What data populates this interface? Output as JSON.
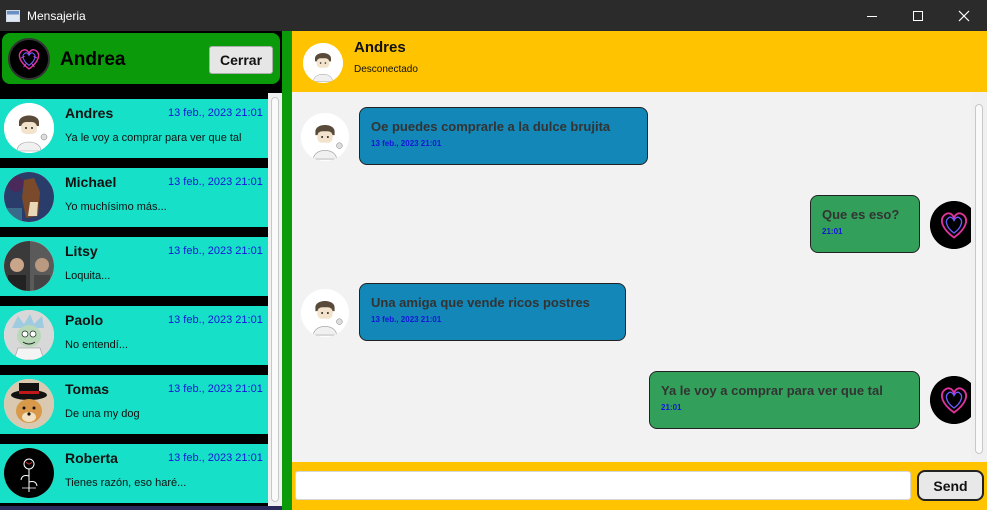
{
  "window": {
    "title": "Mensajeria",
    "controls": [
      "minimize-icon",
      "maximize-icon",
      "close-icon"
    ]
  },
  "profile": {
    "name": "Andrea",
    "close_label": "Cerrar",
    "avatar_icon": "neon-heart-avatar"
  },
  "contacts": [
    {
      "name": "Andres",
      "date": "13 feb., 2023  21:01",
      "last_message": "Ya le voy a comprar para ver que tal",
      "avatar_icon": "cartoon-boy-avatar"
    },
    {
      "name": "Michael",
      "date": "13 feb., 2023  21:01",
      "last_message": "Yo muchísimo más...",
      "avatar_icon": "horse-cartoon-avatar"
    },
    {
      "name": "Litsy",
      "date": "13 feb., 2023  21:01",
      "last_message": "Loquita...",
      "avatar_icon": "photo-collage-avatar"
    },
    {
      "name": "Paolo",
      "date": "13 feb., 2023  21:01",
      "last_message": "No entendí...",
      "avatar_icon": "scientist-cartoon-avatar"
    },
    {
      "name": "Tomas",
      "date": "13 feb., 2023  21:01",
      "last_message": "De una my dog",
      "avatar_icon": "dog-with-hat-avatar"
    },
    {
      "name": "Roberta",
      "date": "13 feb., 2023  21:01",
      "last_message": "Tienes razón, eso haré...",
      "avatar_icon": "dark-rose-avatar"
    }
  ],
  "chat": {
    "contact_name": "Andres",
    "status": "Desconectado",
    "messages": [
      {
        "direction": "in",
        "text": "Oe puedes comprarle a la dulce brujita",
        "time": "13 feb., 2023  21:01"
      },
      {
        "direction": "out",
        "text": "Que es eso?",
        "time": "21:01"
      },
      {
        "direction": "in",
        "text": "Una amiga que vende ricos postres",
        "time": "13 feb., 2023  21:01"
      },
      {
        "direction": "out",
        "text": "Ya le voy a comprar para ver que tal",
        "time": "21:01"
      }
    ],
    "input_value": "",
    "send_label": "Send"
  },
  "colors": {
    "profile_bg": "#0a9a0a",
    "contact_bg": "#17e0c8",
    "header_bg": "#ffc300",
    "incoming_bubble": "#1287b8",
    "outgoing_bubble": "#32a05a",
    "date_text": "#1515d8"
  }
}
